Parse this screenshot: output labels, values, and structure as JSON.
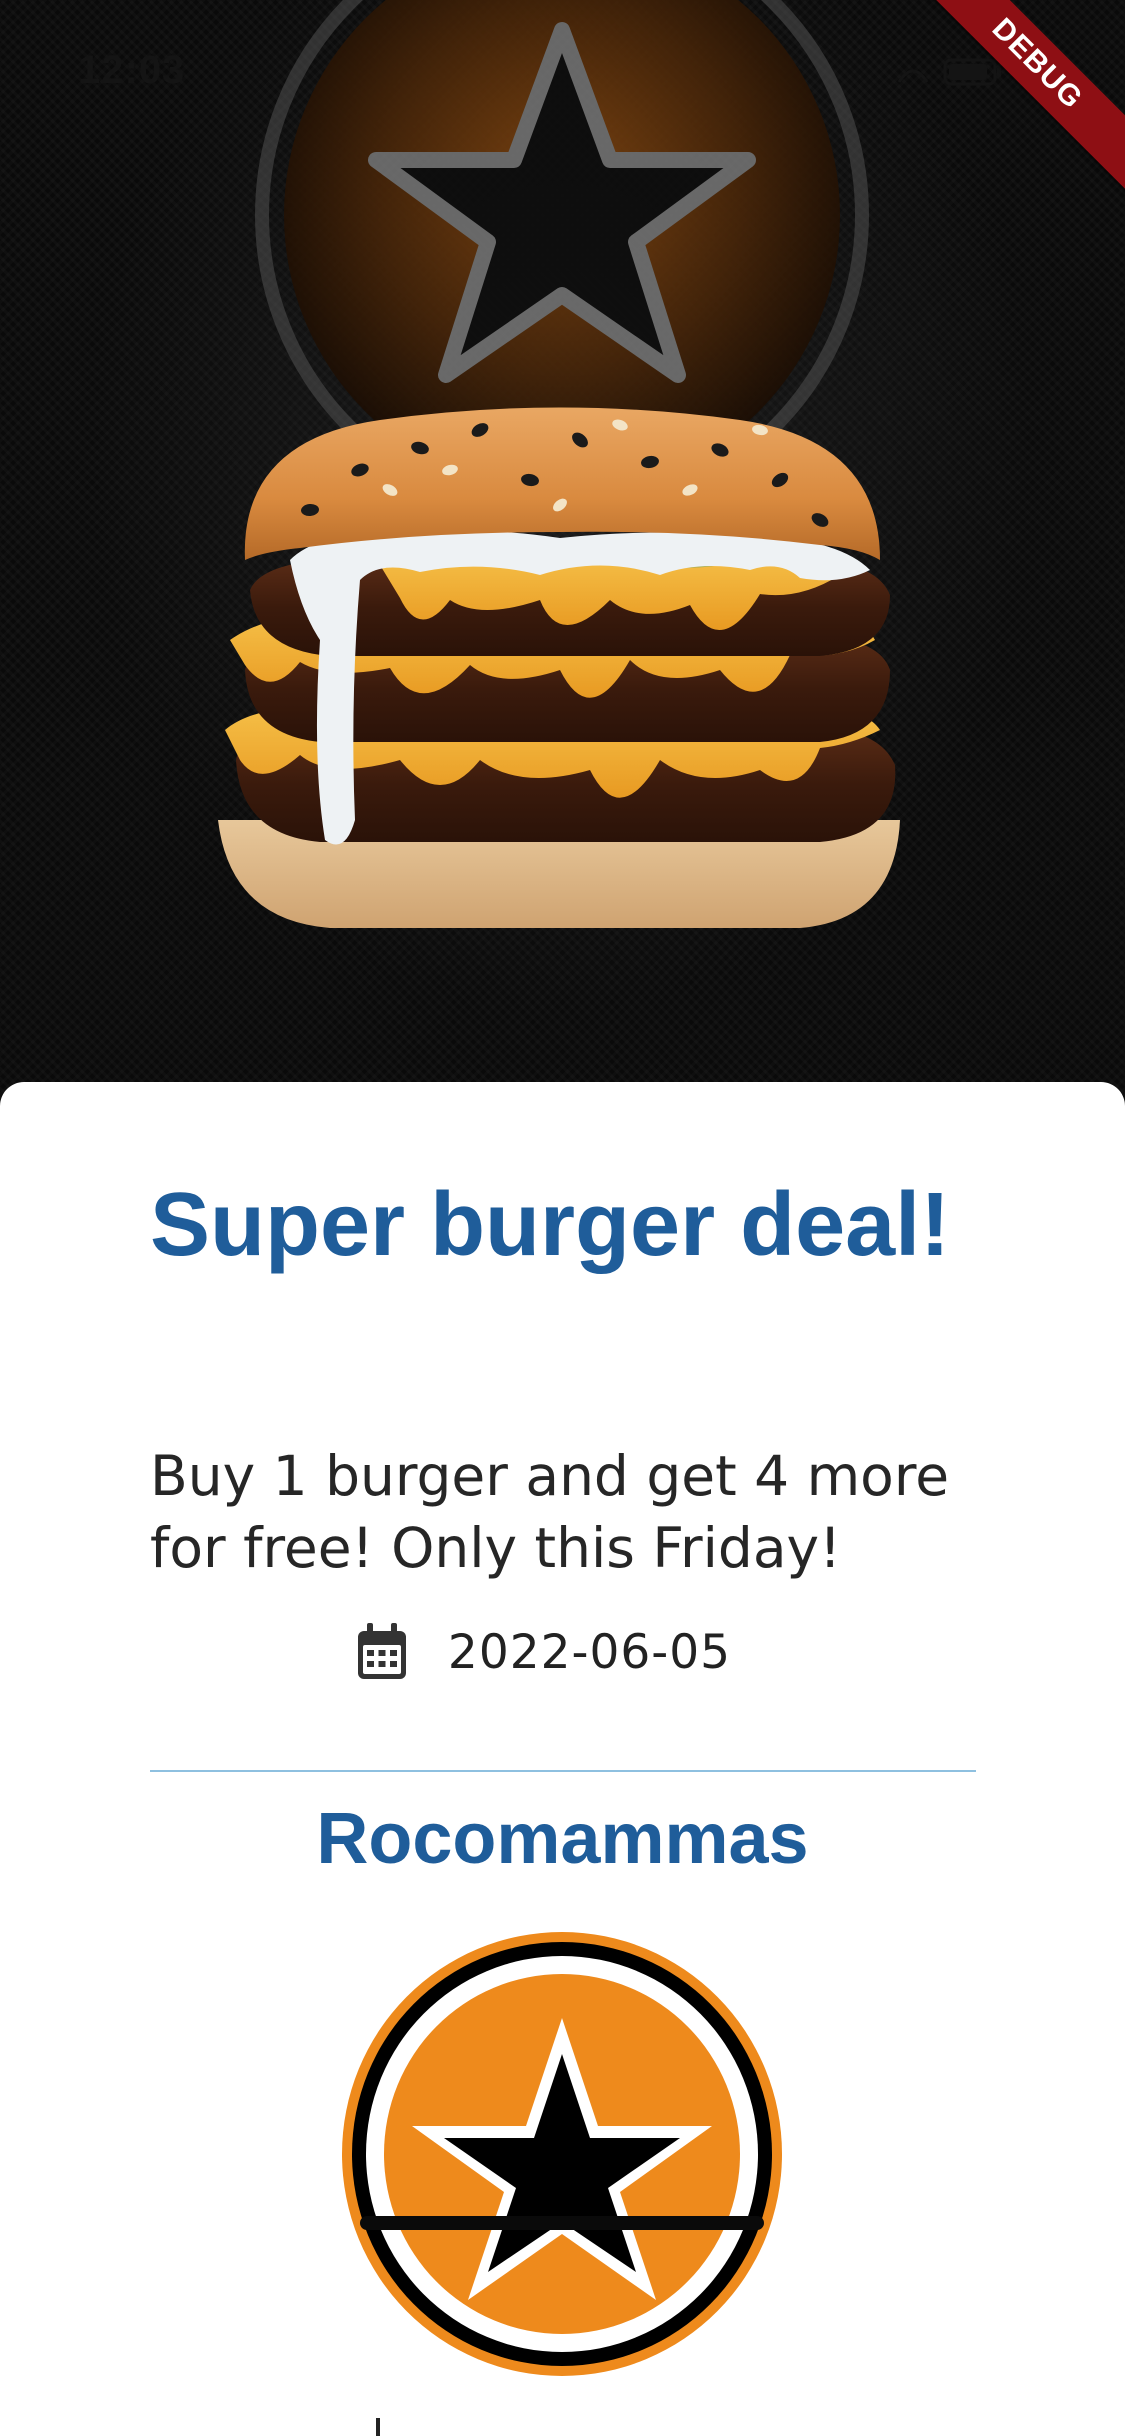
{
  "status_bar": {
    "time": "12:03"
  },
  "debug_banner": {
    "label": "DEBUG"
  },
  "hero": {
    "image": "burger-photo",
    "background_logo": "star-logo"
  },
  "deal": {
    "title": "Super burger deal!",
    "description": "Buy 1 burger and get 4 more for free! Only this Friday!",
    "date_icon": "calendar-icon",
    "date": "2022-06-05"
  },
  "restaurant": {
    "name": "Rocomammas",
    "logo": "star-logo"
  },
  "colors": {
    "title": "#1f5d9a",
    "body_text": "#262626",
    "divider": "#8ec0e0",
    "logo_orange": "#ee8a1c",
    "debug_banner": "#8e0f14"
  }
}
